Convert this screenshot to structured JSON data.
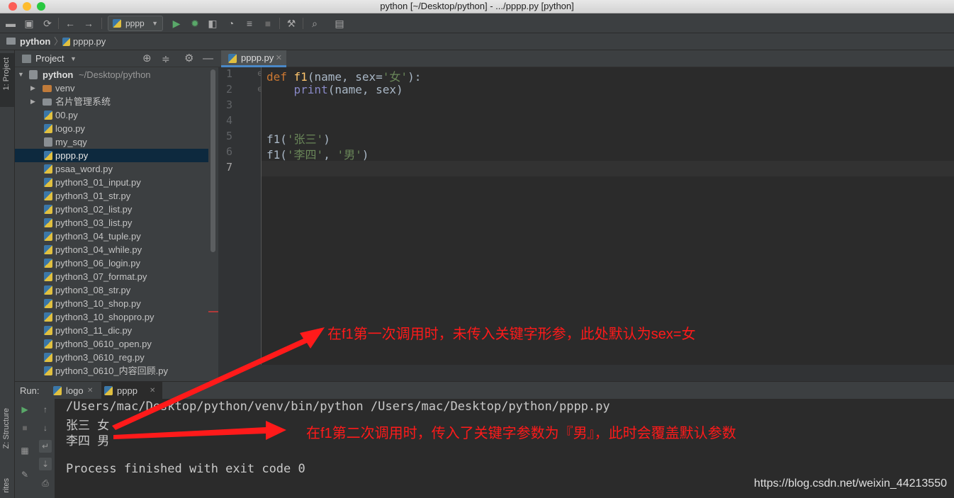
{
  "window": {
    "title": "python [~/Desktop/python] - .../pppp.py [python]"
  },
  "toolbar": {
    "run_config": "pppp"
  },
  "breadcrumb": {
    "project": "python",
    "file": "pppp.py"
  },
  "sidebar_strip": {
    "project_tab": "1: Project",
    "structure_tab": "Z: Structure",
    "favorites_tab": "rites"
  },
  "project_panel": {
    "header": "Project",
    "root_name": "python",
    "root_path": "~/Desktop/python",
    "items": [
      {
        "name": "venv",
        "kind": "folder-excluded"
      },
      {
        "name": "名片管理系统",
        "kind": "folder"
      },
      {
        "name": "00.py",
        "kind": "py"
      },
      {
        "name": "logo.py",
        "kind": "py"
      },
      {
        "name": "my_sqy",
        "kind": "file"
      },
      {
        "name": "pppp.py",
        "kind": "py",
        "selected": true
      },
      {
        "name": "psaa_word.py",
        "kind": "py"
      },
      {
        "name": "python3_01_input.py",
        "kind": "py"
      },
      {
        "name": "python3_01_str.py",
        "kind": "py"
      },
      {
        "name": "python3_02_list.py",
        "kind": "py"
      },
      {
        "name": "python3_03_list.py",
        "kind": "py"
      },
      {
        "name": "python3_04_tuple.py",
        "kind": "py"
      },
      {
        "name": "python3_04_while.py",
        "kind": "py"
      },
      {
        "name": "python3_06_login.py",
        "kind": "py"
      },
      {
        "name": "python3_07_format.py",
        "kind": "py"
      },
      {
        "name": "python3_08_str.py",
        "kind": "py"
      },
      {
        "name": "python3_10_shop.py",
        "kind": "py"
      },
      {
        "name": "python3_10_shoppro.py",
        "kind": "py"
      },
      {
        "name": "python3_11_dic.py",
        "kind": "py"
      },
      {
        "name": "python3_0610_open.py",
        "kind": "py"
      },
      {
        "name": "python3_0610_reg.py",
        "kind": "py"
      },
      {
        "name": "python3_0610_内容回顾.py",
        "kind": "py"
      }
    ]
  },
  "editor": {
    "tab": "pppp.py",
    "line_numbers": [
      "1",
      "2",
      "3",
      "4",
      "5",
      "6",
      "7"
    ],
    "lines": {
      "l1": {
        "kw": "def",
        "fn": "f1",
        "params_a": "(name, sex=",
        "str": "'女'",
        "params_b": "):"
      },
      "l2": {
        "indent": "    ",
        "bi": "print",
        "args": "(name, sex)"
      },
      "l5": {
        "call": "f1(",
        "str": "'张三'",
        "end": ")"
      },
      "l6": {
        "call": "f1(",
        "str1": "'李四'",
        "sep": ", ",
        "str2": "'男'",
        "end": ")"
      }
    }
  },
  "run_panel": {
    "label": "Run:",
    "tabs": [
      "logo",
      "pppp"
    ],
    "console_lines": [
      "/Users/mac/Desktop/python/venv/bin/python /Users/mac/Desktop/python/pppp.py",
      "张三 女",
      "李四 男",
      "",
      "Process finished with exit code 0"
    ]
  },
  "annotations": {
    "first": "在f1第一次调用时，未传入关键字形参，此处默认为sex=女",
    "second": "在f1第二次调用时，传入了关键字参数为『男』，此时会覆盖默认参数",
    "arrow_color": "#ff1a1a"
  },
  "watermark": "https://blog.csdn.net/weixin_44213550"
}
